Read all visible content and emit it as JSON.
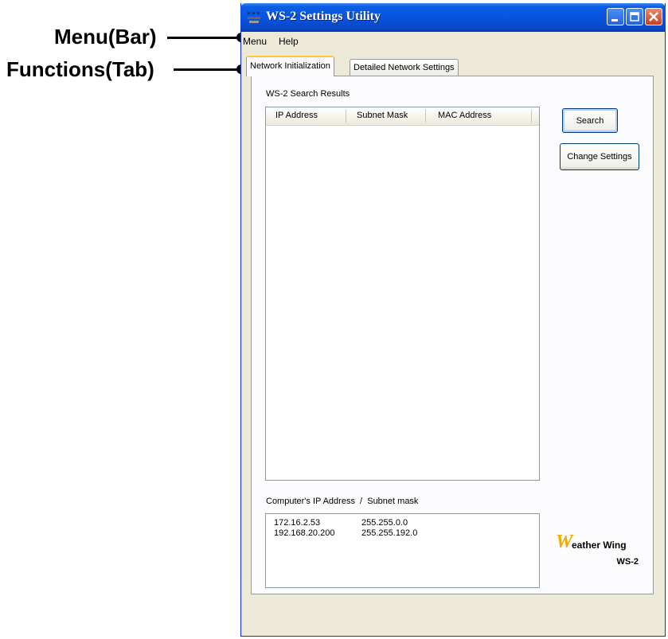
{
  "annotations": {
    "menu_label": "Menu(Bar)",
    "functions_label": "Functions(Tab)"
  },
  "window": {
    "title": "WS-2 Settings Utility",
    "icon": "app-icon",
    "title_bar_color": "#0a5ee6"
  },
  "menubar": {
    "items": [
      "Menu",
      "Help"
    ]
  },
  "tabs": [
    {
      "label": "Network Initialization",
      "active": true
    },
    {
      "label": "Detailed Network Settings",
      "active": false
    }
  ],
  "search_results": {
    "label": "WS-2 Search Results",
    "columns": [
      "IP Address",
      "Subnet Mask",
      "MAC Address"
    ],
    "rows": []
  },
  "buttons": {
    "search": "Search",
    "change_settings": "Change Settings"
  },
  "computer_ip": {
    "label": "Computer's IP Address  /  Subnet mask",
    "rows": [
      {
        "ip": "172.16.2.53",
        "mask": "255.255.0.0"
      },
      {
        "ip": "192.168.20.200",
        "mask": "255.255.192.0"
      }
    ]
  },
  "logo": {
    "initial": "W",
    "text": "eather Wing",
    "model": "WS-2",
    "accent_color": "#f2a900"
  }
}
